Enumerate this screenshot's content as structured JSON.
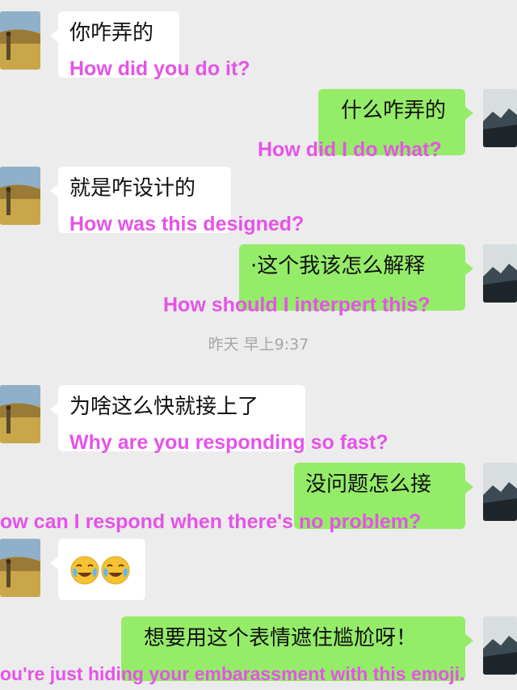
{
  "messages": [
    {
      "side": "left",
      "zh": "你咋弄的",
      "en": "How did you do it?"
    },
    {
      "side": "right",
      "zh": "什么咋弄的",
      "en": "How did I do what?"
    },
    {
      "side": "left",
      "zh": "就是咋设计的",
      "en": "How was this designed?"
    },
    {
      "side": "right",
      "zh": "·这个我该怎么解释",
      "en": "How should I interpert this?"
    },
    {
      "side": "left",
      "zh": "为啥这么快就接上了",
      "en": "Why are you responding so fast?"
    },
    {
      "side": "right",
      "zh": "没问题怎么接",
      "en": "ow can I respond when there's no problem?"
    },
    {
      "side": "left",
      "zh": "",
      "en": "",
      "emoji": [
        "crying-laughing-emoji",
        "crying-laughing-emoji"
      ]
    },
    {
      "side": "right",
      "zh": "想要用这个表情遮住尴尬呀！",
      "en": "ou're just hiding your embarassment with this emoji."
    }
  ],
  "timestamp": "昨天 早上9:37",
  "colors": {
    "background": "#ececec",
    "incoming_bubble": "#ffffff",
    "outgoing_bubble": "#95ec69",
    "translation": "#e553e8",
    "timestamp": "#a6a6a6"
  }
}
